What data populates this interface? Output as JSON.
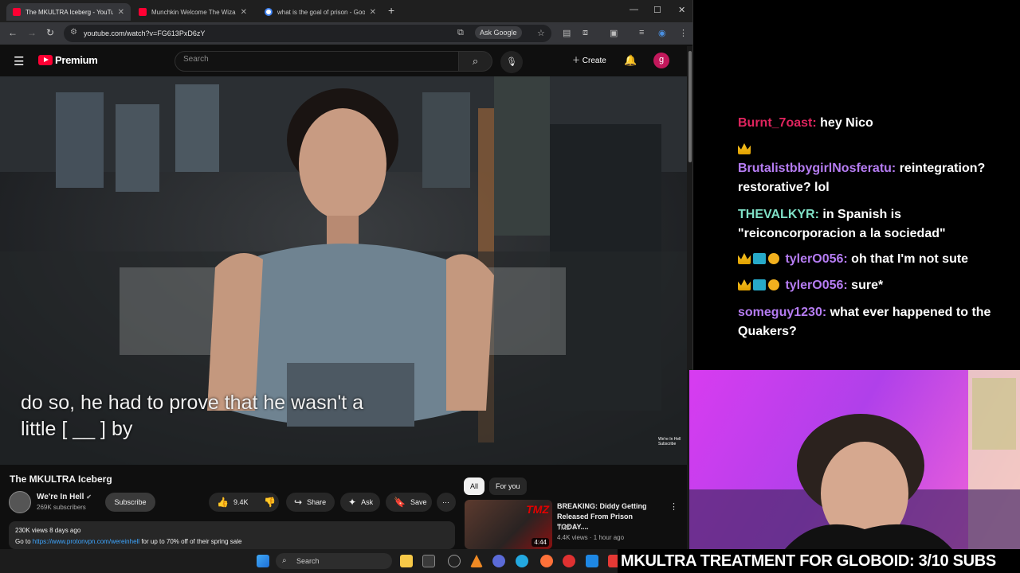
{
  "browser": {
    "tabs": [
      {
        "title": "The MKULTRA Iceberg - YouTube",
        "active": true,
        "favicon": "youtube"
      },
      {
        "title": "Munchkin Welcome The Wizard",
        "active": false,
        "favicon": "youtube"
      },
      {
        "title": "what is the goal of prison - Google",
        "active": false,
        "favicon": "google"
      }
    ],
    "url": "youtube.com/watch?v=FG613PxD6zY",
    "ask_google": "Ask Google"
  },
  "youtube": {
    "logo_text": "Premium",
    "search_placeholder": "Search",
    "create_label": "Create",
    "avatar_letter": "g",
    "caption_line1": "do so, he had to prove that he wasn't a",
    "caption_line2": "little [ __ ] by",
    "watermark": "We're In Hell Subscribe",
    "video_title": "The MKULTRA Iceberg",
    "channel_name": "We're In Hell",
    "channel_subs": "269K subscribers",
    "subscribe_label": "Subscribe",
    "likes": "9.4K",
    "share_label": "Share",
    "ask_label": "Ask",
    "save_label": "Save",
    "views_date": "230K views  8 days ago",
    "desc_prefix": "Go to ",
    "desc_link": "https://www.protonvpn.com/wereinhell",
    "desc_suffix": " for up to 70% off of their spring sale",
    "chips": [
      "All",
      "For you"
    ],
    "rec_title": "BREAKING: Diddy Getting Released From Prison TODAY....",
    "rec_channel": "TMZ",
    "rec_stats": "4.4K views · 1 hour ago",
    "rec_duration": "4:44",
    "rec_logo": "TMZ"
  },
  "chat": [
    {
      "user": "Burnt_7oast:",
      "color": "#e0245e",
      "text": "hey Nico",
      "badges": []
    },
    {
      "user": "",
      "color": "#ffffff",
      "text": "",
      "badges": [
        "crown"
      ]
    },
    {
      "user": "BrutalistbbygirlNosferatu:",
      "color": "#b57cf2",
      "text": "reintegration? restorative? lol",
      "badges": []
    },
    {
      "user": "THEVALKYR:",
      "color": "#7fe0c6",
      "text": "in Spanish is \"reiconcorporacion a la sociedad\"",
      "badges": []
    },
    {
      "user": "tylerO056:",
      "color": "#b57cf2",
      "text": "oh that I'm not sute",
      "badges": [
        "crown",
        "sub",
        "one"
      ]
    },
    {
      "user": "tylerO056:",
      "color": "#b57cf2",
      "text": "sure*",
      "badges": [
        "crown",
        "sub",
        "one"
      ]
    },
    {
      "user": "someguy1230:",
      "color": "#b57cf2",
      "text": "what ever happened to the Quakers?",
      "badges": []
    }
  ],
  "taskbar": {
    "search_label": "Search"
  },
  "banner": "MKULTRA TREATMENT FOR GLOBOID: 3/10 SUBS"
}
